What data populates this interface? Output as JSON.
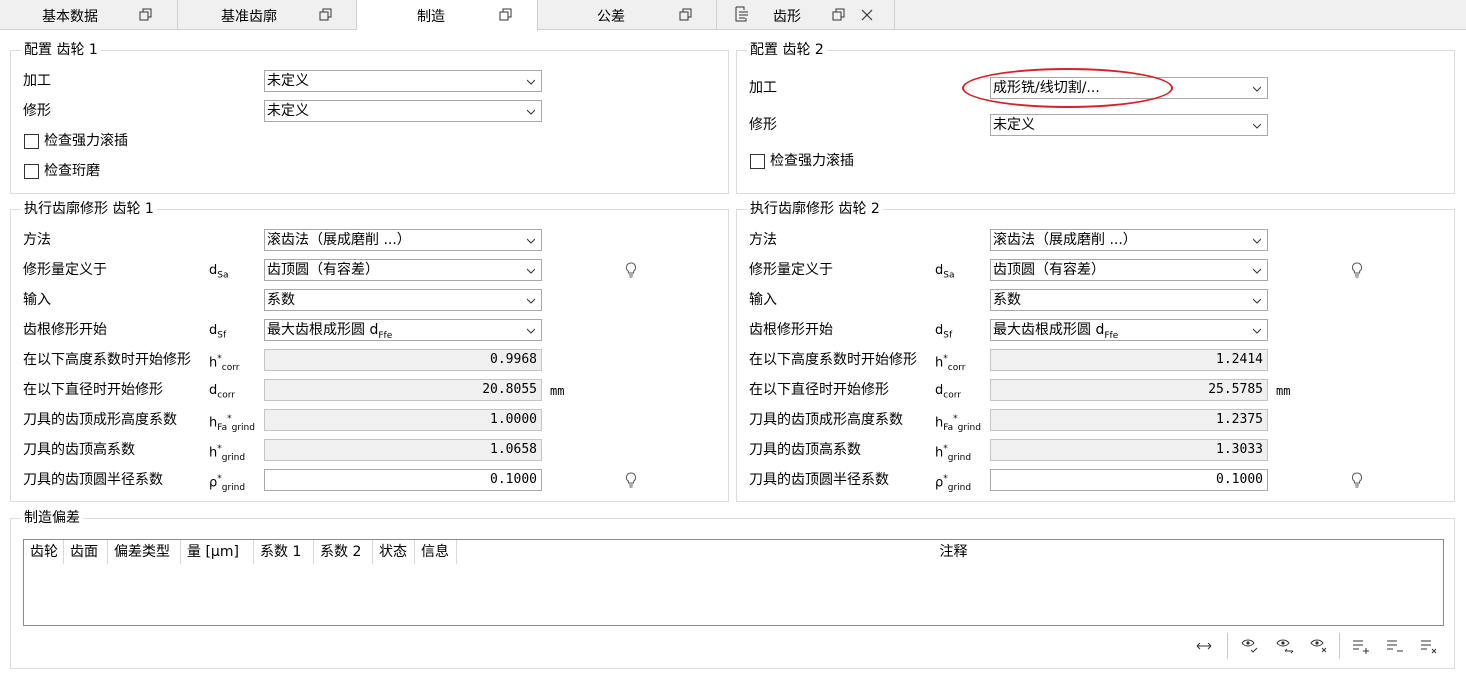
{
  "tabs": [
    {
      "label": "基本数据",
      "icon": "restore-window-icon"
    },
    {
      "label": "基准齿廓",
      "icon": "restore-window-icon"
    },
    {
      "label": "制造",
      "icon": "restore-window-icon",
      "active": true
    },
    {
      "label": "公差",
      "icon": "restore-window-icon"
    },
    {
      "label": "齿形",
      "icon": "restore-window-icon",
      "leading_icon": "document-list-icon",
      "closable": true
    }
  ],
  "config1": {
    "title": "配置 齿轮 1",
    "processing_label": "加工",
    "processing_value": "未定义",
    "modification_label": "修形",
    "modification_value": "未定义",
    "check_power_skiving": "检查强力滚插",
    "check_honing": "检查珩磨"
  },
  "config2": {
    "title": "配置 齿轮 2",
    "processing_label": "加工",
    "processing_value": "成形铣/线切割/...",
    "modification_label": "修形",
    "modification_value": "未定义",
    "check_power_skiving": "检查强力滚插"
  },
  "exec1": {
    "title": "执行齿廓修形 齿轮 1",
    "method_label": "方法",
    "method_value": "滚齿法（展成磨削 ...）",
    "def_label": "修形量定义于",
    "def_value": "齿顶圆（有容差）",
    "input_label": "输入",
    "input_value": "系数",
    "root_label": "齿根修形开始",
    "root_value": "最大齿根成形圆 d",
    "hcorr_label": "在以下高度系数时开始修形",
    "hcorr_value": "0.9968",
    "dcorr_label": "在以下直径时开始修形",
    "dcorr_value": "20.8055",
    "dcorr_unit": "mm",
    "hfa_label": "刀具的齿顶成形高度系数",
    "hfa_value": "1.0000",
    "hgrind_label": "刀具的齿顶高系数",
    "hgrind_value": "1.0658",
    "rho_label": "刀具的齿顶圆半径系数",
    "rho_value": "0.1000"
  },
  "exec2": {
    "title": "执行齿廓修形 齿轮 2",
    "method_label": "方法",
    "method_value": "滚齿法（展成磨削 ...）",
    "def_label": "修形量定义于",
    "def_value": "齿顶圆（有容差）",
    "input_label": "输入",
    "input_value": "系数",
    "root_label": "齿根修形开始",
    "root_value": "最大齿根成形圆 d",
    "hcorr_label": "在以下高度系数时开始修形",
    "hcorr_value": "1.2414",
    "dcorr_label": "在以下直径时开始修形",
    "dcorr_value": "25.5785",
    "dcorr_unit": "mm",
    "hfa_label": "刀具的齿顶成形高度系数",
    "hfa_value": "1.2375",
    "hgrind_label": "刀具的齿顶高系数",
    "hgrind_value": "1.3033",
    "rho_label": "刀具的齿顶圆半径系数",
    "rho_value": "0.1000"
  },
  "symbols": {
    "d": "d",
    "h": "h",
    "rho": "ρ",
    "star": "*",
    "sa": "Sa",
    "sf": "Sf",
    "corr": "corr",
    "fa": "Fa",
    "grind": "grind",
    "ffe": "Ffe"
  },
  "deviation": {
    "title": "制造偏差",
    "columns": [
      "齿轮",
      "齿面",
      "偏差类型",
      "量 [μm]",
      "系数 1",
      "系数 2",
      "状态",
      "信息",
      "注释"
    ],
    "rows": []
  },
  "toolbar_icons": [
    "swap-horizontal-icon",
    "eye-check-icon",
    "eye-swap-icon",
    "eye-remove-icon",
    "list-add-icon",
    "list-remove-icon",
    "list-clear-icon"
  ],
  "colors": {
    "highlight_ring": "#d6202a",
    "group_border": "#dcdcdc",
    "readonly_bg": "#f0f0f0"
  }
}
